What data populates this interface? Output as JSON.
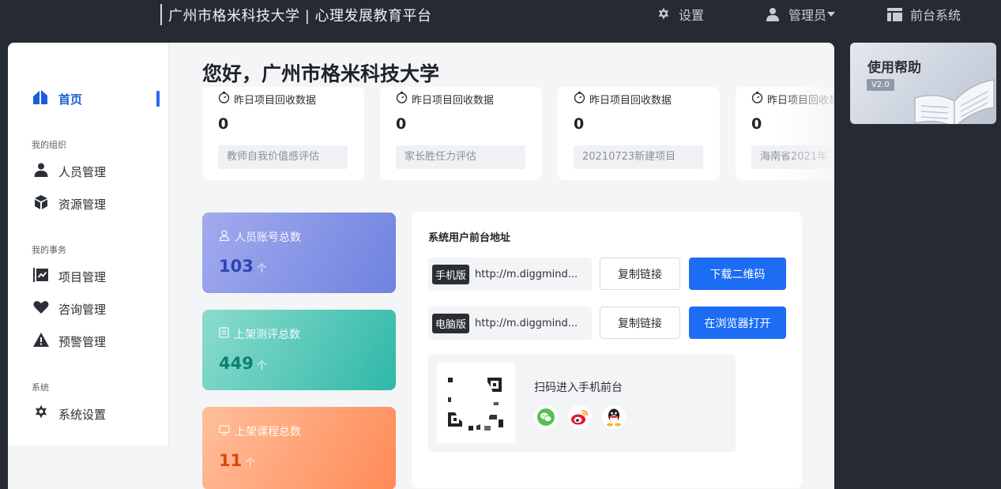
{
  "header": {
    "title": "广州市格米科技大学 | 心理发展教育平台",
    "settings_label": "设置",
    "user_label": "管理员",
    "frontend_label": "前台系统"
  },
  "sidebar": {
    "items": [
      {
        "label": "首页",
        "icon": "home-icon",
        "active": true
      },
      {
        "section": "我的组织"
      },
      {
        "label": "人员管理",
        "icon": "person-icon"
      },
      {
        "label": "资源管理",
        "icon": "cube-icon"
      },
      {
        "section": "我的事务"
      },
      {
        "label": "项目管理",
        "icon": "chart-icon"
      },
      {
        "label": "咨询管理",
        "icon": "heart-icon"
      },
      {
        "label": "预警管理",
        "icon": "warning-icon"
      },
      {
        "section": "系统"
      },
      {
        "label": "系统设置",
        "icon": "gear-icon"
      }
    ]
  },
  "main": {
    "greeting": "您好，广州市格米科技大学",
    "project_cards": [
      {
        "label": "昨日项目回收数据",
        "value": "0",
        "project": "教师自我价值感评估"
      },
      {
        "label": "昨日项目回收数据",
        "value": "0",
        "project": "家长胜任力评估"
      },
      {
        "label": "昨日项目回收数据",
        "value": "0",
        "project": "20210723新建项目"
      },
      {
        "label": "昨日项目回收数据",
        "value": "0",
        "project": "海南省2021年"
      }
    ],
    "stats": [
      {
        "label": "人员账号总数",
        "value": "103",
        "unit": "个",
        "icon": "user-outline-icon",
        "color": "#7b8ce6"
      },
      {
        "label": "上架测评总数",
        "value": "449",
        "unit": "个",
        "icon": "document-icon",
        "color": "#3cc3b3"
      },
      {
        "label": "上架课程总数",
        "value": "11",
        "unit": "个",
        "icon": "monitor-icon",
        "color": "#ff9a6a"
      }
    ],
    "address": {
      "title": "系统用户前台地址",
      "rows": [
        {
          "badge": "手机版",
          "url": "http://m.diggmind...",
          "copy": "复制链接",
          "action": "下载二维码"
        },
        {
          "badge": "电脑版",
          "url": "http://m.diggmind...",
          "copy": "复制链接",
          "action": "在浏览器打开"
        }
      ],
      "qr_text": "扫码进入手机前台",
      "share_icons": [
        "wechat-icon",
        "weibo-icon",
        "qq-icon"
      ]
    }
  },
  "help": {
    "title": "使用帮助",
    "version": "V2.0"
  }
}
